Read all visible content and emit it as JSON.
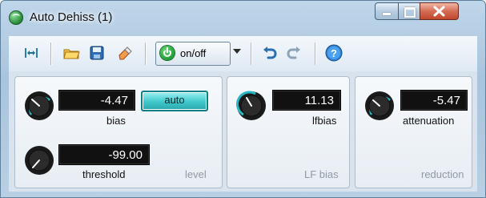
{
  "window": {
    "title": "Auto Dehiss (1)"
  },
  "titlebar": {
    "controls": {
      "minimize": "minimize",
      "maximize": "maximize",
      "close": "close"
    }
  },
  "toolbar": {
    "icons": [
      "pin-icon",
      "open-folder-icon",
      "save-icon",
      "eraser-icon",
      "power-icon",
      "undo-icon",
      "redo-icon",
      "help-icon"
    ],
    "onoff_label": "on/off"
  },
  "panels": {
    "level": {
      "bias": {
        "value": "-4.47",
        "label": "bias"
      },
      "threshold": {
        "value": "-99.00",
        "label": "threshold"
      },
      "auto_label": "auto",
      "section_label": "level"
    },
    "lfbias": {
      "lfbias": {
        "value": "11.13",
        "label": "lfbias"
      },
      "section_label": "LF bias"
    },
    "reduction": {
      "attenuation": {
        "value": "-5.47",
        "label": "attenuation"
      },
      "section_label": "reduction"
    }
  },
  "colors": {
    "accent": "#28b8c3",
    "lcd_bg": "#111111",
    "auto_fill": "#3fc7ca",
    "power_green": "#1e9b35"
  }
}
